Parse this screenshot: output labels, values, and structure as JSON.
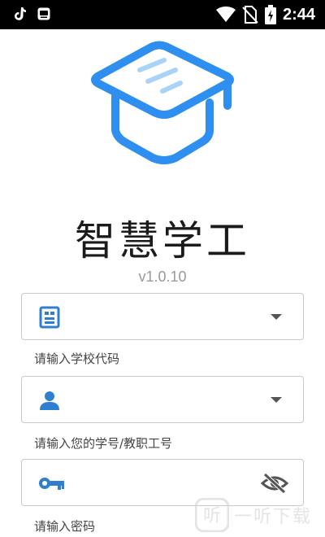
{
  "status_bar": {
    "time": "2:44",
    "icons": [
      "tiktok-icon",
      "app-notification-icon",
      "wifi-icon",
      "no-sim-icon",
      "battery-icon"
    ]
  },
  "app": {
    "title": "智慧学工",
    "version": "v1.0.10",
    "accent": "#2f8ff0"
  },
  "form": {
    "school_code": {
      "hint": "请输入学校代码",
      "value": ""
    },
    "account": {
      "hint": "请输入您的学号/教职工号",
      "value": ""
    },
    "password": {
      "hint": "请输入密码",
      "value": ""
    }
  },
  "watermark": {
    "text": "一听下载"
  }
}
